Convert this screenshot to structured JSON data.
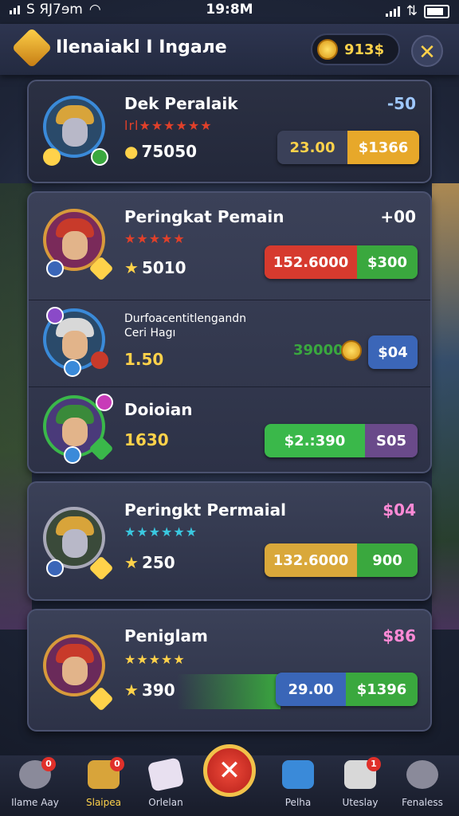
{
  "status": {
    "carrier": "S ЯJ7ɘm",
    "time": "19:8M"
  },
  "header": {
    "title": "Ilenaiakl I Ingaлe",
    "coins": "913$",
    "close_label": "✕"
  },
  "players": [
    {
      "name": "Dek Peralaik",
      "stars": "lrl★★★★★★",
      "star_color": "#e0402a",
      "score": "75050",
      "delta": "-50",
      "delta_color": "#9fc8ff",
      "pill_left": "23.00",
      "pill_right": "$1366",
      "pill_left_color": "#3a4058",
      "pill_right_color": "#e7a82a",
      "left_text_color": "#ffd24a"
    },
    {
      "name": "Peringkat Pemain",
      "stars": "★★★★★",
      "star_color": "#e0402a",
      "score": "5010",
      "delta": "+00",
      "delta_color": "#ffffff",
      "pill_left": "152.6000",
      "pill_right": "$300",
      "pill_left_color": "#d63a2e",
      "pill_right_color": "#3aa83e",
      "left_text_color": "#ffffff"
    },
    {
      "name": "Durfoacentitlengandn\nCeri Hagı",
      "score": "1.50",
      "delta_text": "39000",
      "delta_color": "#3aa83e",
      "pill_right": "$04",
      "pill_right_color": "#3b66b8"
    },
    {
      "name": "Doioian",
      "score": "1630",
      "pill_left": "$2.:390",
      "pill_right": "S05",
      "pill_left_color": "#3ab84a",
      "pill_right_color": "#6a4a8a",
      "left_text_color": "#ffffff"
    },
    {
      "name": "Peringkt Permaial",
      "stars": "★★★★★★",
      "star_color": "#3ac8e0",
      "score": "250",
      "delta": "$04",
      "delta_color": "#ff8ad6",
      "pill_left": "132.6000",
      "pill_right": "900",
      "pill_left_color": "#d9a83a",
      "pill_right_color": "#3aa83e",
      "left_text_color": "#ffffff"
    },
    {
      "name": "Peniglam",
      "stars": "★★★★★",
      "star_color": "#ffd24a",
      "score": "390",
      "delta": "$86",
      "delta_color": "#ff8ad6",
      "pill_left": "29.00",
      "pill_right": "$1396",
      "pill_left_color": "#3a66b8",
      "pill_right_color": "#3aa83e",
      "left_text_color": "#ffffff"
    }
  ],
  "nav": [
    {
      "label": "Ilame Aay",
      "badge": "0"
    },
    {
      "label": "Slaipea",
      "badge": "0"
    },
    {
      "label": "Orlelan"
    },
    {
      "label": "Pelha"
    },
    {
      "label": "Uteslay",
      "badge": "1"
    },
    {
      "label": "Fenaless"
    }
  ],
  "center_button": "✕",
  "colors": {
    "accent": "#ffd24a",
    "background": "#1e2538"
  }
}
